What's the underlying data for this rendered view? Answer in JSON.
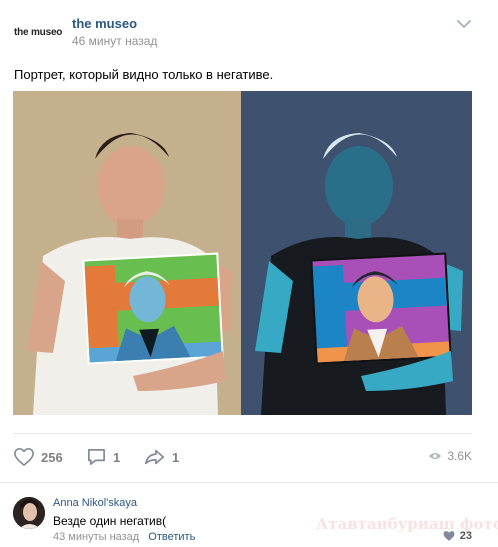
{
  "post": {
    "author": "the museo",
    "avatar_logo": "the museo",
    "time": "46 минут назад",
    "text": "Портрет, который видно только в негативе."
  },
  "actions": {
    "likes": "256",
    "comments": "1",
    "shares": "1",
    "views": "3.6K"
  },
  "comment": {
    "author": "Anna Nikol'skaya",
    "text": "Везде один негатив(",
    "time": "43 минуты назад",
    "reply_label": "Ответить",
    "likes": "23",
    "watermark": "Атавтанбуриаш фото.РП"
  },
  "icons": {
    "more": "chevron-down-icon",
    "like": "heart-icon",
    "comment": "comment-icon",
    "share": "share-icon",
    "views": "eye-icon",
    "comment_like": "heart-icon"
  },
  "colors": {
    "link": "#2a5885",
    "muted": "#939393",
    "action_gray": "#828282",
    "divider": "#e7e8ec"
  }
}
